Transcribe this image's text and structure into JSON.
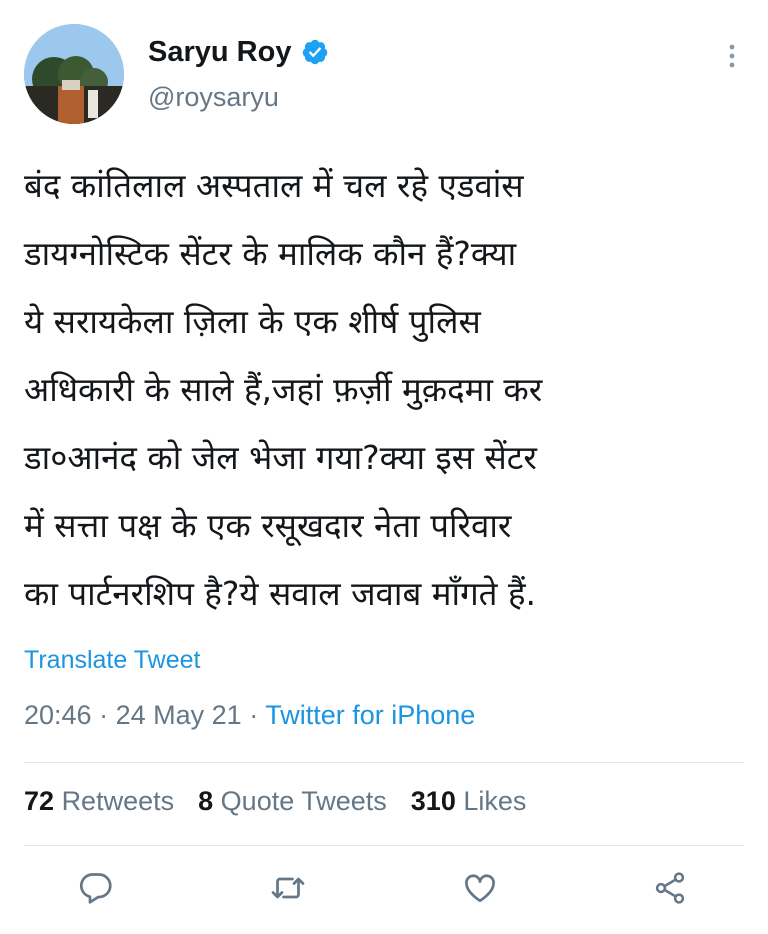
{
  "header": {
    "display_name": "Saryu Roy",
    "handle": "@roysaryu",
    "verified_icon": "verified-badge-icon",
    "more_icon": "more-vertical-icon"
  },
  "tweet": {
    "text": "बंद कांतिलाल अस्पताल में चल रहे एडवांस डायग्नोस्टिक सेंटर के मालिक कौन हैं?क्या ये सरायकेला ज़िला के एक शीर्ष पुलिस अधिकारी के साले हैं,जहां फ़र्ज़ी मुक़दमा कर डा०आनंद को जेल भेजा गया?क्या इस सेंटर में सत्ता पक्ष के एक रसूखदार नेता परिवार का पार्टनरशिप है?ये सवाल जवाब माँगते हैं.",
    "lines": [
      "बंद कांतिलाल अस्पताल में चल रहे एडवांस",
      "डायग्नोस्टिक सेंटर के मालिक कौन हैं?क्या",
      "ये सरायकेला ज़िला के एक शीर्ष पुलिस",
      "अधिकारी के साले हैं,जहां फ़र्ज़ी मुक़दमा कर",
      "डा०आनंद को जेल भेजा गया?क्या इस सेंटर",
      "में सत्ता पक्ष के एक रसूखदार नेता परिवार",
      "का पार्टनरशिप है?ये सवाल जवाब माँगते हैं."
    ],
    "translate_label": "Translate Tweet",
    "time": "20:46",
    "separator": "·",
    "date": "24 May 21",
    "app": "Twitter for iPhone"
  },
  "stats": {
    "retweets_count": "72",
    "retweets_label": "Retweets",
    "quotes_count": "8",
    "quotes_label": "Quote Tweets",
    "likes_count": "310",
    "likes_label": "Likes"
  },
  "actions": {
    "reply_icon": "reply-icon",
    "retweet_icon": "retweet-icon",
    "like_icon": "heart-icon",
    "share_icon": "share-icon"
  },
  "colors": {
    "text": "#14171a",
    "secondary": "#657786",
    "link": "#1b95e0",
    "divider": "#e1e8ed"
  }
}
